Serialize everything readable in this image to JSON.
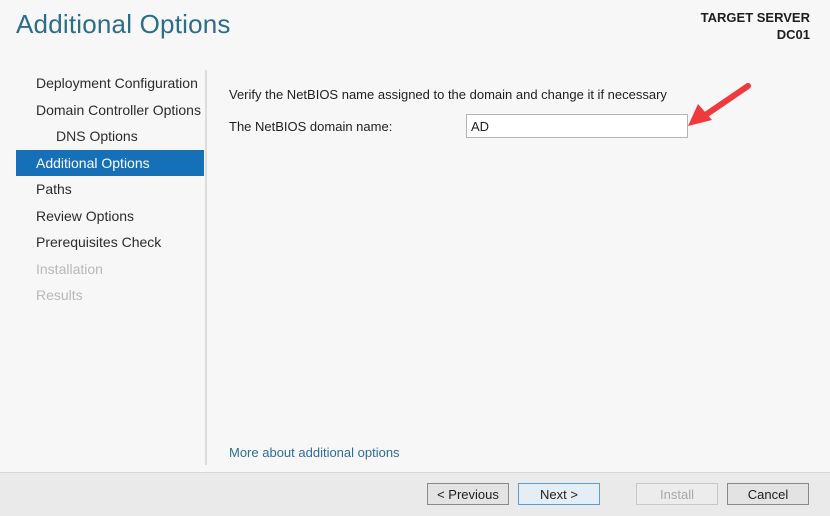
{
  "header": {
    "title": "Additional Options",
    "target_server_label": "TARGET SERVER",
    "target_server_name": "DC01"
  },
  "sidebar": {
    "items": [
      {
        "label": "Deployment Configuration",
        "state": "normal"
      },
      {
        "label": "Domain Controller Options",
        "state": "normal"
      },
      {
        "label": "DNS Options",
        "state": "sub"
      },
      {
        "label": "Additional Options",
        "state": "active"
      },
      {
        "label": "Paths",
        "state": "normal"
      },
      {
        "label": "Review Options",
        "state": "normal"
      },
      {
        "label": "Prerequisites Check",
        "state": "normal"
      },
      {
        "label": "Installation",
        "state": "disabled"
      },
      {
        "label": "Results",
        "state": "disabled"
      }
    ]
  },
  "main": {
    "instruction": "Verify the NetBIOS name assigned to the domain and change it if necessary",
    "netbios_label": "The NetBIOS domain name:",
    "netbios_value": "AD",
    "more_link": "More about additional options"
  },
  "annotation": {
    "arrow_color": "#f0393c"
  },
  "footer": {
    "previous_label": "< Previous",
    "next_label": "Next >",
    "install_label": "Install",
    "cancel_label": "Cancel"
  }
}
